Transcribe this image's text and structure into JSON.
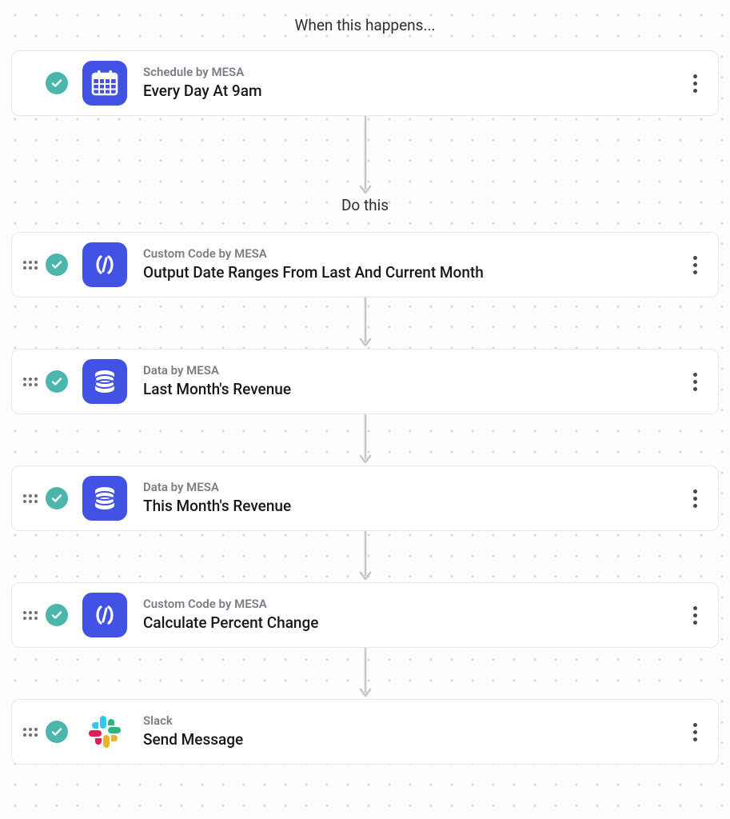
{
  "section_trigger_label": "When this happens...",
  "section_action_label": "Do this",
  "trigger": {
    "status": "ok",
    "app_label": "Schedule by MESA",
    "title": "Every Day At 9am",
    "icon": "schedule"
  },
  "actions": [
    {
      "status": "ok",
      "app_label": "Custom Code by MESA",
      "title": "Output Date Ranges From Last And Current Month",
      "icon": "code"
    },
    {
      "status": "ok",
      "app_label": "Data by MESA",
      "title": "Last Month's Revenue",
      "icon": "data"
    },
    {
      "status": "ok",
      "app_label": "Data by MESA",
      "title": "This Month's Revenue",
      "icon": "data"
    },
    {
      "status": "ok",
      "app_label": "Custom Code by MESA",
      "title": "Calculate Percent Change",
      "icon": "code"
    },
    {
      "status": "ok",
      "app_label": "Slack",
      "title": "Send Message",
      "icon": "slack"
    }
  ]
}
